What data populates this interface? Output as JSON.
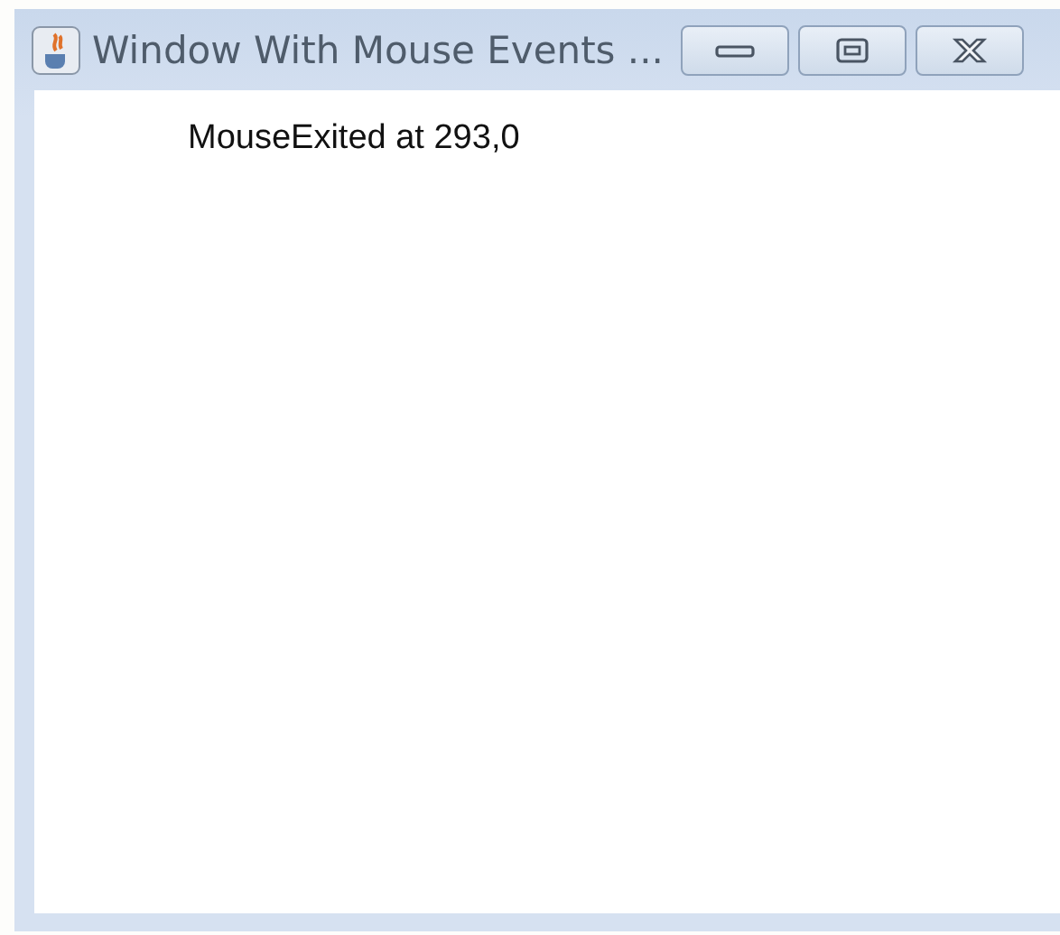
{
  "window": {
    "title": "Window With Mouse Events ..."
  },
  "content": {
    "message": "MouseExited at 293,0"
  }
}
